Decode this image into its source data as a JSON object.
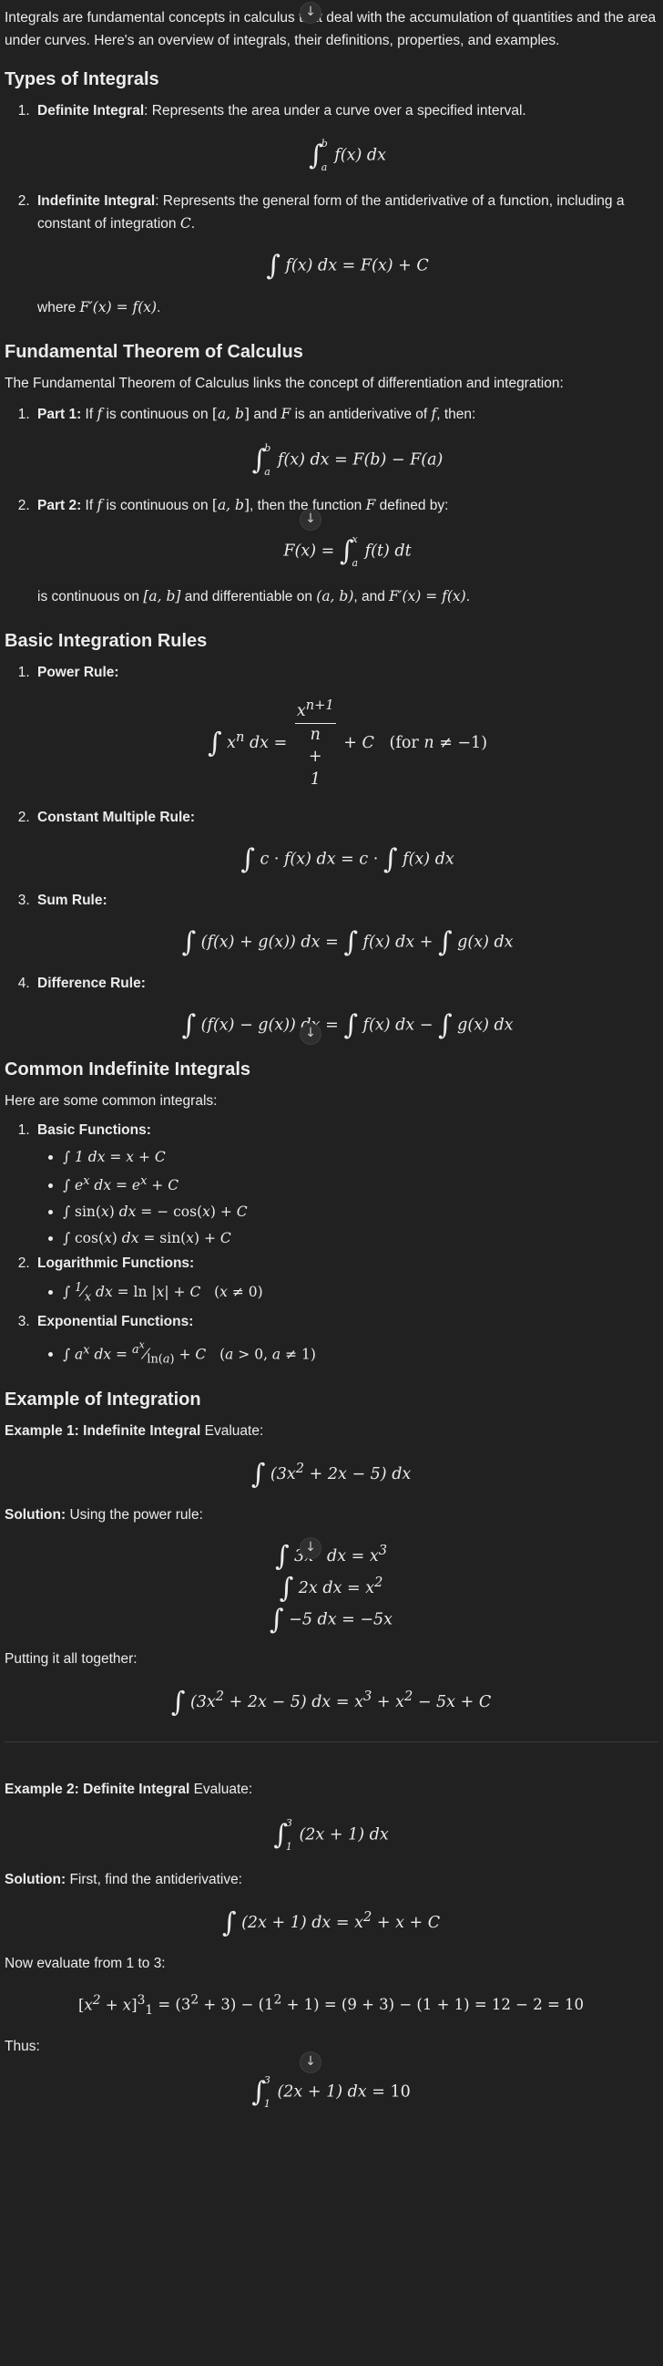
{
  "intro": "Integrals are fundamental concepts in calculus that deal with the accumulation of quantities and the area under curves. Here's an overview of integrals, their definitions, properties, and examples.",
  "types": {
    "heading": "Types of Integrals",
    "definite": {
      "label": "Definite Integral",
      "text": ": Represents the area under a curve over a specified interval."
    },
    "indefinite": {
      "label": "Indefinite Integral",
      "text": ": Represents the general form of the antiderivative of a function, including a constant of integration "
    },
    "where": "where "
  },
  "ftc": {
    "heading": "Fundamental Theorem of Calculus",
    "intro": "The Fundamental Theorem of Calculus links the concept of differentiation and integration:",
    "part1": {
      "label": "Part 1:"
    },
    "part2": {
      "label": "Part 2:"
    }
  },
  "rules": {
    "heading": "Basic Integration Rules",
    "power": "Power Rule:",
    "constant": "Constant Multiple Rule:",
    "sum": "Sum Rule:",
    "difference": "Difference Rule:"
  },
  "common": {
    "heading": "Common Indefinite Integrals",
    "intro": "Here are some common integrals:",
    "basic": "Basic Functions:",
    "log": "Logarithmic Functions:",
    "exp": "Exponential Functions:"
  },
  "example": {
    "heading": "Example of Integration",
    "ex1_label": "Example 1: Indefinite Integral",
    "evaluate": " Evaluate:",
    "solution_label": "Solution:",
    "solution1_text": " Using the power rule:",
    "together": "Putting it all together:",
    "ex2_label": "Example 2: Definite Integral",
    "solution2_text": " First, find the antiderivative:",
    "now_eval": "Now evaluate from 1 to 3:",
    "thus": "Thus:"
  }
}
